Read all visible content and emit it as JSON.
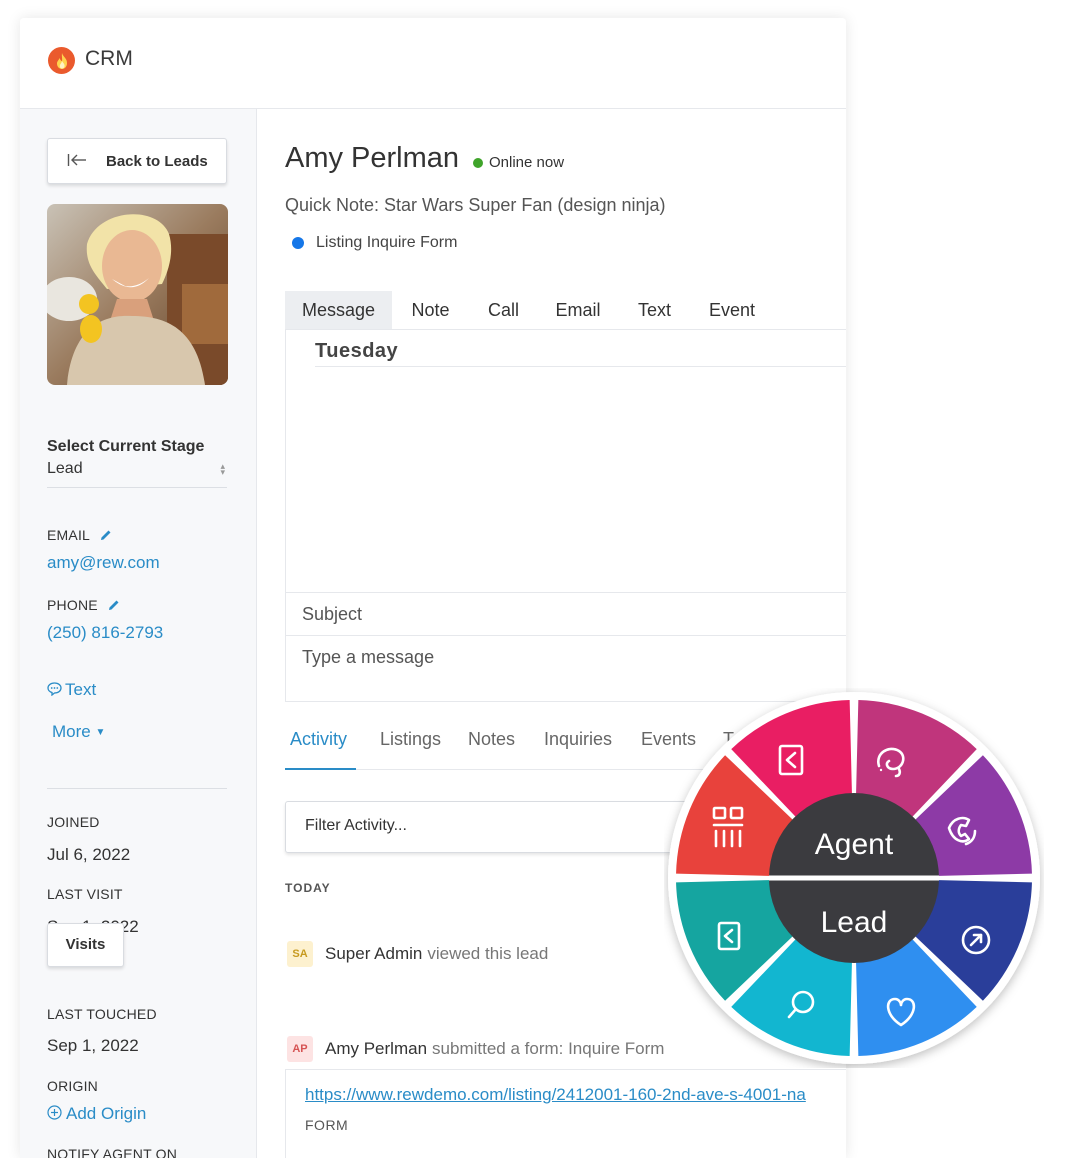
{
  "app": {
    "title": "CRM"
  },
  "sidebar": {
    "back_label": "Back to Leads",
    "stage_label": "Select Current Stage",
    "stage_value": "Lead",
    "email_label": "EMAIL",
    "email_value": "amy@rew.com",
    "phone_label": "PHONE",
    "phone_value": "(250) 816-2793",
    "text_link": "Text",
    "more_link": "More",
    "joined_label": "JOINED",
    "joined_value": "Jul 6, 2022",
    "last_visit_label": "LAST VISIT",
    "last_visit_value": "Sep 1, 2022",
    "visits_button": "Visits",
    "last_touched_label": "LAST TOUCHED",
    "last_touched_value": "Sep 1, 2022",
    "origin_label": "ORIGIN",
    "add_origin": "Add Origin",
    "notify_label": "NOTIFY AGENT ON"
  },
  "lead": {
    "name": "Amy Perlman",
    "status": "Online now",
    "quick_note": "Quick Note: Star Wars Super Fan (design ninja)",
    "source": "Listing Inquire Form"
  },
  "compose": {
    "tabs": [
      "Message",
      "Note",
      "Call",
      "Email",
      "Text",
      "Event"
    ],
    "active_tab": "Message",
    "day_heading": "Tuesday",
    "subject_placeholder": "Subject",
    "message_placeholder": "Type a message"
  },
  "activity": {
    "tabs": [
      "Activity",
      "Listings",
      "Notes",
      "Inquiries",
      "Events",
      "T"
    ],
    "active_tab": "Activity",
    "filter_label": "Filter Activity...",
    "section_label": "TODAY",
    "items": [
      {
        "initials": "SA",
        "who": "Super Admin",
        "action": "viewed this lead"
      },
      {
        "initials": "AP",
        "who": "Amy Perlman",
        "action": "submitted a form: Inquire Form"
      }
    ],
    "url": "https://www.rewdemo.com/listing/2412001-160-2nd-ave-s-4001-na",
    "url_type": "FORM"
  },
  "wheel": {
    "top_label": "Agent",
    "bottom_label": "Lead",
    "segment_colors": [
      "#e91e63",
      "#c0357c",
      "#8d3aa6",
      "#2a3e9a",
      "#2f8ff0",
      "#12b6d0",
      "#15a5a0",
      "#e8423c"
    ],
    "center_color": "#3b3b3f",
    "segment_icons": [
      "back-icon",
      "lasso-icon",
      "phone-icon",
      "arrow-out-icon",
      "heart-icon",
      "search-icon",
      "back-icon",
      "grid-icon"
    ]
  }
}
